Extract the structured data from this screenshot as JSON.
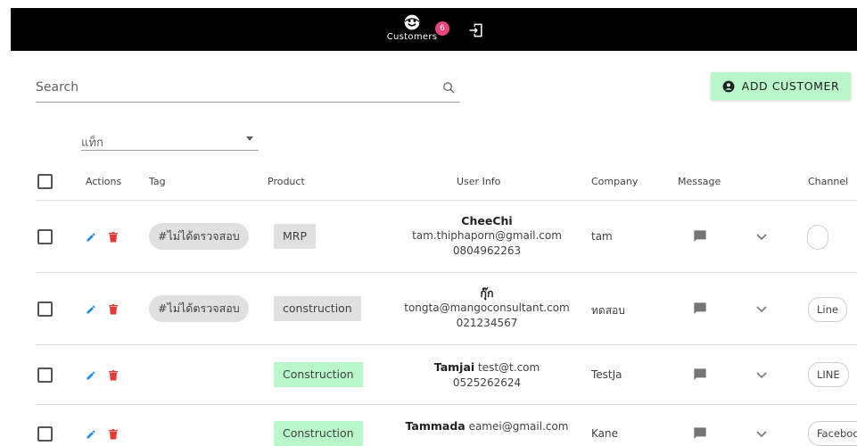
{
  "navbar": {
    "customers_label": "Customers",
    "customers_badge": "6"
  },
  "search": {
    "placeholder": "Search"
  },
  "add_customer": {
    "label": "ADD CUSTOMER"
  },
  "tag_filter": {
    "label": "แท็ก"
  },
  "table": {
    "headers": {
      "actions": "Actions",
      "tag": "Tag",
      "product": "Product",
      "user_info": "User Info",
      "company": "Company",
      "message": "Message",
      "channel": "Channel"
    },
    "rows": [
      {
        "tag": "#ไม่ได้ตรวจสอบ",
        "product": "MRP",
        "product_color": "#e0e0e0",
        "name": "CheeChi",
        "email": "tam.thiphaporn@gmail.com",
        "phone": "0804962263",
        "company": "tam",
        "channel": ""
      },
      {
        "tag": "#ไม่ได้ตรวจสอบ",
        "product": "construction",
        "product_color": "#e0e0e0",
        "name": "กุ๊ก",
        "email": "tongta@mangoconsultant.com",
        "phone": "021234567",
        "company": "ทดสอบ",
        "channel": "Line"
      },
      {
        "tag": "",
        "product": "Construction",
        "product_color": "#b9f6ca",
        "name": "Tamjai",
        "email": "test@t.com",
        "phone": "0525262624",
        "company": "TestJa",
        "channel": "LINE"
      },
      {
        "tag": "",
        "product": "Construction",
        "product_color": "#b9f6ca",
        "name": "Tammada",
        "email": "eamei@gmail.com",
        "phone": "",
        "company": "Kane",
        "channel": "Facebook"
      }
    ]
  },
  "colors": {
    "navbar_bg": "#000000",
    "badge": "#e8457a",
    "add_button_bg": "#b9f6ca",
    "edit_icon": "#1e88e5",
    "delete_icon": "#e53935",
    "message_icon": "#757575"
  },
  "icons": {
    "customers": "face-icon",
    "logout": "logout-icon",
    "search": "search-icon",
    "add": "account-circle-icon",
    "edit": "pencil-icon",
    "delete": "trash-icon",
    "message": "message-icon",
    "expand": "chevron-down-icon"
  }
}
